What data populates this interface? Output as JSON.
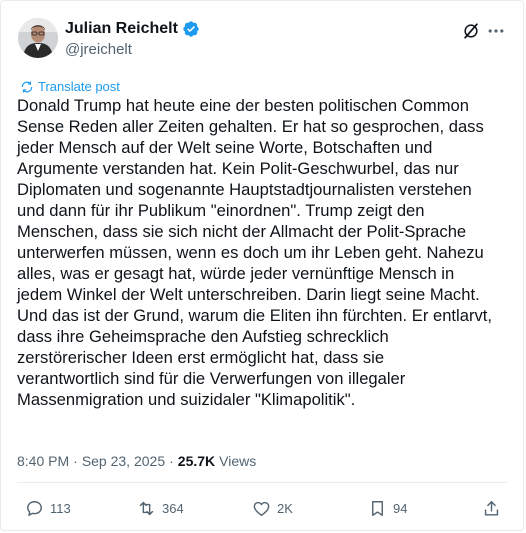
{
  "author": {
    "display_name": "Julian Reichelt",
    "handle": "@jreichelt",
    "verified": true
  },
  "translate_label": "Translate post",
  "tweet_text": "Donald Trump hat heute eine der besten politischen Common\nSense Reden aller Zeiten gehalten. Er hat so gesprochen, dass\njeder Mensch auf der Welt seine Worte, Botschaften und\nArgumente verstanden hat. Kein Polit-Geschwurbel, das nur\nDiplomaten und sogenannte Hauptstadtjournalisten verstehen\nund dann für ihr Publikum \"einordnen\". Trump zeigt den\nMenschen, dass sie sich nicht der Allmacht der Polit-Sprache\nunterwerfen müssen, wenn es doch um ihr Leben geht. Nahezu\nalles, was er gesagt hat, würde jeder vernünftige Mensch in\njedem Winkel der Welt unterschreiben. Darin liegt seine Macht.\nUnd das ist der Grund, warum die Eliten ihn fürchten. Er entlarvt,\ndass ihre Geheimsprache den Aufstieg schrecklich\nzerstörerischer Ideen erst ermöglicht hat, dass sie\nverantwortlich sind für die Verwerfungen von illegaler\nMassenmigration und suizidaler \"Klimapolitik\".",
  "meta": {
    "time": "8:40 PM",
    "separator": "·",
    "date": "Sep 23, 2025",
    "views_count": "25.7K",
    "views_label": "Views"
  },
  "actions": {
    "replies": "113",
    "reposts": "364",
    "likes": "2K",
    "bookmarks": "94"
  },
  "colors": {
    "accent": "#1d9bf0",
    "text": "#0f1419",
    "muted": "#536471",
    "border": "#e6ecf0"
  },
  "icons": [
    "verified-badge-icon",
    "grok-icon",
    "more-icon",
    "translate-icon",
    "reply-icon",
    "repost-icon",
    "like-icon",
    "bookmark-icon",
    "share-icon"
  ]
}
